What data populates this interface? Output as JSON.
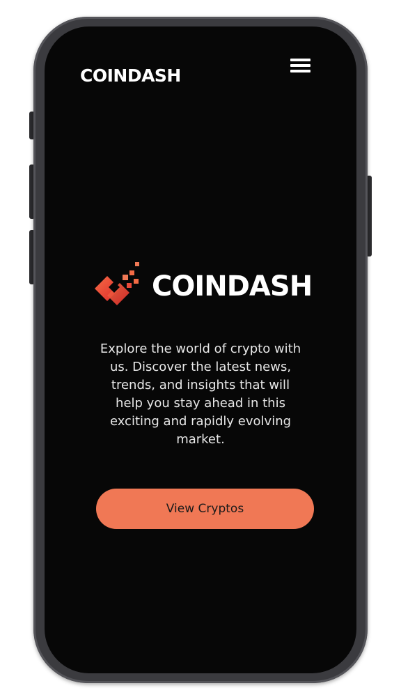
{
  "header": {
    "brand": "COINDASH",
    "menu_icon": "hamburger-menu-icon"
  },
  "hero": {
    "logo_icon": "coindash-logo-icon",
    "brand": "COINDASH",
    "description": "Explore the world of crypto with us. Discover the latest news, trends, and insights that will help you stay ahead in this exciting and rapidly evolving market.",
    "cta_label": "View Cryptos"
  },
  "colors": {
    "screen_background": "#070707",
    "accent": "#f07855",
    "logo_gradient_start": "#f46b45",
    "logo_gradient_end": "#e02a2a",
    "text": "#ffffff",
    "device_frame": "#3b3b3f"
  }
}
